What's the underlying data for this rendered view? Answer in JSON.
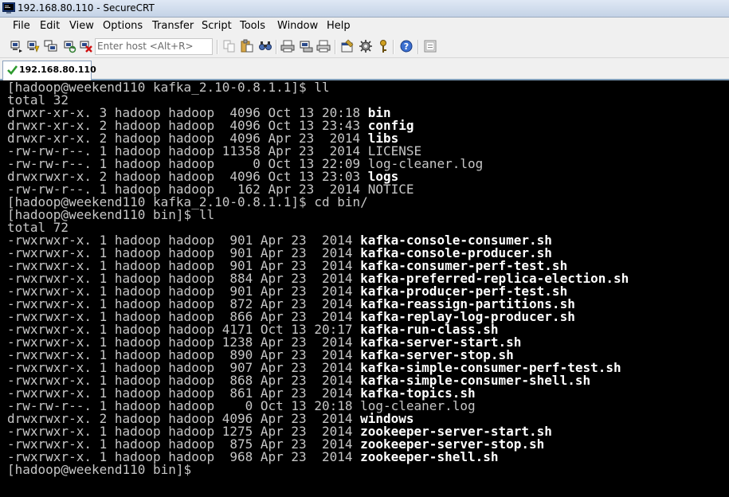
{
  "window": {
    "title": "192.168.80.110 - SecureCRT"
  },
  "menu": [
    "File",
    "Edit",
    "View",
    "Options",
    "Transfer",
    "Script",
    "Tools",
    "Window",
    "Help"
  ],
  "toolbar": {
    "host_placeholder": "Enter host <Alt+R>",
    "icons": [
      "connect-icon",
      "quick-connect-icon",
      "connect-in-tab-icon",
      "reconnect-icon",
      "disconnect-icon",
      "copy-icon",
      "paste-icon",
      "find-icon",
      "print-icon",
      "print-setup-icon",
      "print-screen-icon",
      "session-options-icon",
      "global-options-icon",
      "keymap-icon",
      "help-icon",
      "sftp-icon"
    ]
  },
  "tab": {
    "label": "192.168.80.110",
    "status_icon": "check-icon"
  },
  "terminal": {
    "lines": [
      [
        {
          "t": "[hadoop@weekend110 kafka_2.10-0.8.1.1]$ ll"
        }
      ],
      [
        {
          "t": "total 32"
        }
      ],
      [
        {
          "t": "drwxr-xr-x. 3 hadoop hadoop  4096 Oct 13 20:18 "
        },
        {
          "t": "bin",
          "b": true
        }
      ],
      [
        {
          "t": "drwxr-xr-x. 2 hadoop hadoop  4096 Oct 13 23:43 "
        },
        {
          "t": "config",
          "b": true
        }
      ],
      [
        {
          "t": "drwxr-xr-x. 2 hadoop hadoop  4096 Apr 23  2014 "
        },
        {
          "t": "libs",
          "b": true
        }
      ],
      [
        {
          "t": "-rw-rw-r--. 1 hadoop hadoop 11358 Apr 23  2014 LICENSE"
        }
      ],
      [
        {
          "t": "-rw-rw-r--. 1 hadoop hadoop     0 Oct 13 22:09 log-cleaner.log"
        }
      ],
      [
        {
          "t": "drwxrwxr-x. 2 hadoop hadoop  4096 Oct 13 23:03 "
        },
        {
          "t": "logs",
          "b": true
        }
      ],
      [
        {
          "t": "-rw-rw-r--. 1 hadoop hadoop   162 Apr 23  2014 NOTICE"
        }
      ],
      [
        {
          "t": "[hadoop@weekend110 kafka_2.10-0.8.1.1]$ cd bin/"
        }
      ],
      [
        {
          "t": "[hadoop@weekend110 bin]$ ll"
        }
      ],
      [
        {
          "t": "total 72"
        }
      ],
      [
        {
          "t": "-rwxrwxr-x. 1 hadoop hadoop  901 Apr 23  2014 "
        },
        {
          "t": "kafka-console-consumer.sh",
          "b": true
        }
      ],
      [
        {
          "t": "-rwxrwxr-x. 1 hadoop hadoop  901 Apr 23  2014 "
        },
        {
          "t": "kafka-console-producer.sh",
          "b": true
        }
      ],
      [
        {
          "t": "-rwxrwxr-x. 1 hadoop hadoop  901 Apr 23  2014 "
        },
        {
          "t": "kafka-consumer-perf-test.sh",
          "b": true
        }
      ],
      [
        {
          "t": "-rwxrwxr-x. 1 hadoop hadoop  884 Apr 23  2014 "
        },
        {
          "t": "kafka-preferred-replica-election.sh",
          "b": true
        }
      ],
      [
        {
          "t": "-rwxrwxr-x. 1 hadoop hadoop  901 Apr 23  2014 "
        },
        {
          "t": "kafka-producer-perf-test.sh",
          "b": true
        }
      ],
      [
        {
          "t": "-rwxrwxr-x. 1 hadoop hadoop  872 Apr 23  2014 "
        },
        {
          "t": "kafka-reassign-partitions.sh",
          "b": true
        }
      ],
      [
        {
          "t": "-rwxrwxr-x. 1 hadoop hadoop  866 Apr 23  2014 "
        },
        {
          "t": "kafka-replay-log-producer.sh",
          "b": true
        }
      ],
      [
        {
          "t": "-rwxrwxr-x. 1 hadoop hadoop 4171 Oct 13 20:17 "
        },
        {
          "t": "kafka-run-class.sh",
          "b": true
        }
      ],
      [
        {
          "t": "-rwxrwxr-x. 1 hadoop hadoop 1238 Apr 23  2014 "
        },
        {
          "t": "kafka-server-start.sh",
          "b": true
        }
      ],
      [
        {
          "t": "-rwxrwxr-x. 1 hadoop hadoop  890 Apr 23  2014 "
        },
        {
          "t": "kafka-server-stop.sh",
          "b": true
        }
      ],
      [
        {
          "t": "-rwxrwxr-x. 1 hadoop hadoop  907 Apr 23  2014 "
        },
        {
          "t": "kafka-simple-consumer-perf-test.sh",
          "b": true
        }
      ],
      [
        {
          "t": "-rwxrwxr-x. 1 hadoop hadoop  868 Apr 23  2014 "
        },
        {
          "t": "kafka-simple-consumer-shell.sh",
          "b": true
        }
      ],
      [
        {
          "t": "-rwxrwxr-x. 1 hadoop hadoop  861 Apr 23  2014 "
        },
        {
          "t": "kafka-topics.sh",
          "b": true
        }
      ],
      [
        {
          "t": "-rw-rw-r--. 1 hadoop hadoop    0 Oct 13 20:18 log-cleaner.log"
        }
      ],
      [
        {
          "t": "drwxrwxr-x. 2 hadoop hadoop 4096 Apr 23  2014 "
        },
        {
          "t": "windows",
          "b": true
        }
      ],
      [
        {
          "t": "-rwxrwxr-x. 1 hadoop hadoop 1275 Apr 23  2014 "
        },
        {
          "t": "zookeeper-server-start.sh",
          "b": true
        }
      ],
      [
        {
          "t": "-rwxrwxr-x. 1 hadoop hadoop  875 Apr 23  2014 "
        },
        {
          "t": "zookeeper-server-stop.sh",
          "b": true
        }
      ],
      [
        {
          "t": "-rwxrwxr-x. 1 hadoop hadoop  968 Apr 23  2014 "
        },
        {
          "t": "zookeeper-shell.sh",
          "b": true
        }
      ],
      [
        {
          "t": "[hadoop@weekend110 bin]$ "
        }
      ]
    ]
  },
  "colors": {
    "terminal_bg": "#000000",
    "terminal_fg": "#c6c6c6",
    "terminal_bold": "#ffffff",
    "tab_check": "#2e9a2e"
  }
}
